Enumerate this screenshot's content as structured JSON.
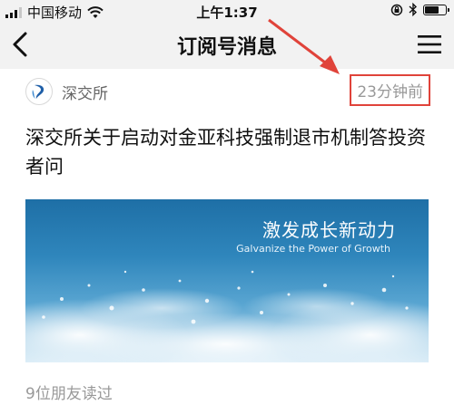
{
  "status_bar": {
    "carrier": "中国移动",
    "time": "上午1:37"
  },
  "nav": {
    "title": "订阅号消息",
    "back_icon": "chevron-left-icon",
    "menu_icon": "hamburger-menu-icon"
  },
  "article": {
    "source_name": "深交所",
    "time_ago": "23分钟前",
    "title": "深交所关于启动对金亚科技强制退市机制答投资者问",
    "cover_title_cn": "激发成长新动力",
    "cover_title_en": "Galvanize  the Power of Growth",
    "read_count": "9位朋友读过"
  },
  "colors": {
    "annotation_red": "#e0433a",
    "muted_text": "#999999",
    "cover_blue": "#2f86bc"
  }
}
